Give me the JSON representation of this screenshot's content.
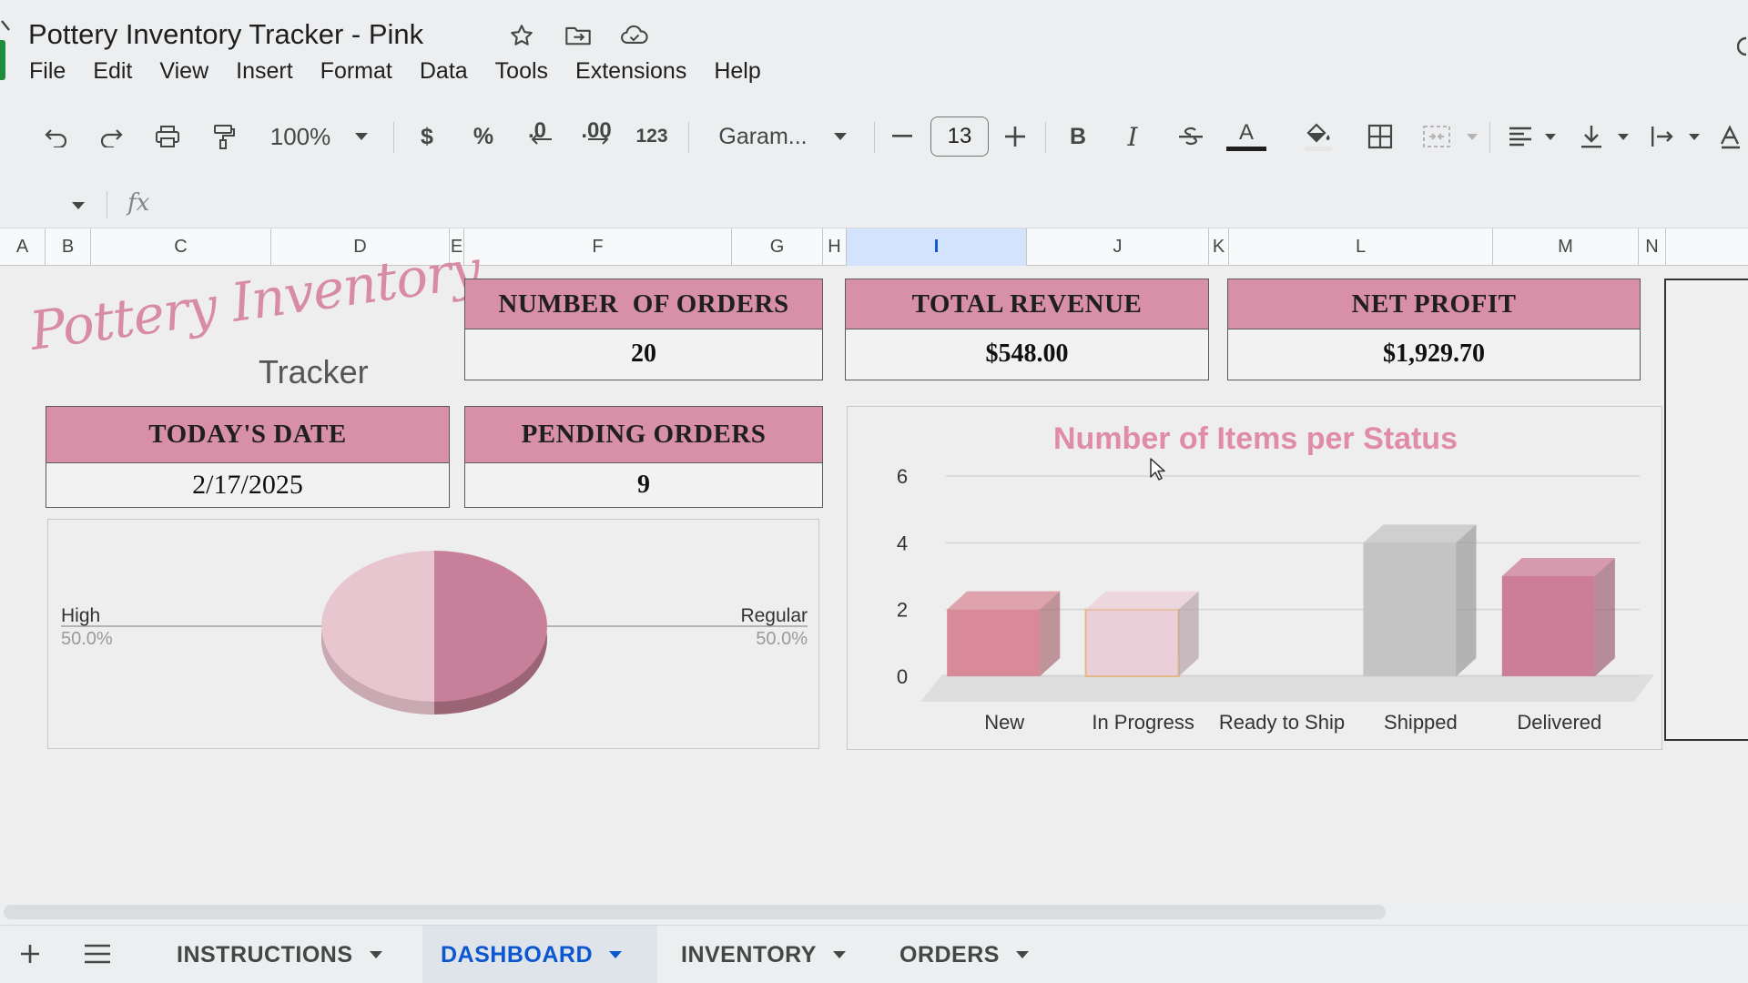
{
  "document": {
    "title": "Pottery Inventory Tracker - Pink"
  },
  "menu": [
    "File",
    "Edit",
    "View",
    "Insert",
    "Format",
    "Data",
    "Tools",
    "Extensions",
    "Help"
  ],
  "toolbar": {
    "zoom": "100%",
    "currency": "$",
    "percent": "%",
    "decrease_decimal": ".0",
    "increase_decimal": ".00",
    "number_format": "123",
    "font": "Garam...",
    "font_size": "13",
    "bold": "B",
    "italic": "I",
    "text_color_letter": "A"
  },
  "formula_bar": {
    "fx": "fx"
  },
  "columns": [
    "A",
    "B",
    "C",
    "D",
    "E",
    "F",
    "G",
    "H",
    "I",
    "J",
    "K",
    "L",
    "M",
    "N"
  ],
  "selected_column": "I",
  "logo": {
    "script": "Pottery Inventory",
    "sub": "Tracker"
  },
  "kpis": {
    "orders": {
      "label": "NUMBER  OF ORDERS",
      "value": "20"
    },
    "revenue": {
      "label": "TOTAL REVENUE",
      "value": "$548.00"
    },
    "profit": {
      "label": "NET PROFIT",
      "value": "$1,929.70"
    },
    "date": {
      "label": "TODAY'S DATE",
      "value": "2/17/2025"
    },
    "pending": {
      "label": "PENDING ORDERS",
      "value": "9"
    }
  },
  "colors": {
    "kpi_header": "#d88fa8",
    "pie_light": "#e8c6d0",
    "pie_dark": "#c8809a",
    "bar_new": "#d98a98",
    "bar_in_progress": "#ebcfd8",
    "bar_ready": "#a6a6a6",
    "bar_shipped": "#c4c4c4",
    "bar_delivered": "#cc7e98",
    "chart_title": "#e08ca6",
    "active_tab": "#0b57d0"
  },
  "chart_data": [
    {
      "type": "pie",
      "slices": [
        {
          "name": "High",
          "value": 50.0,
          "label": "50.0%"
        },
        {
          "name": "Regular",
          "value": 50.0,
          "label": "50.0%"
        }
      ]
    },
    {
      "type": "bar",
      "title": "Number of Items per Status",
      "categories": [
        "New",
        "In Progress",
        "Ready to Ship",
        "Shipped",
        "Delivered"
      ],
      "values": [
        2,
        2,
        0,
        4,
        3
      ],
      "ylim": [
        0,
        6
      ],
      "yticks": [
        "0",
        "2",
        "4",
        "6"
      ],
      "grid": true,
      "three_d": true
    }
  ],
  "sheet_tabs": [
    {
      "label": "INSTRUCTIONS",
      "active": false
    },
    {
      "label": "DASHBOARD",
      "active": true
    },
    {
      "label": "INVENTORY",
      "active": false
    },
    {
      "label": "ORDERS",
      "active": false
    }
  ]
}
